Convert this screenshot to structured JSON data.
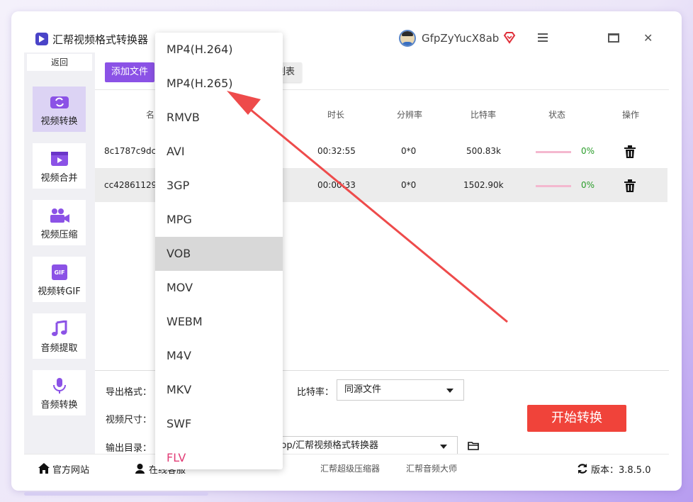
{
  "window": {
    "title": "汇帮视频格式转换器",
    "username": "GfpZyYucX8ab"
  },
  "sidebar": {
    "back_label": "返回",
    "items": [
      {
        "label": "视频转换",
        "icon": "video-convert-icon",
        "active": true
      },
      {
        "label": "视频合并",
        "icon": "video-merge-icon",
        "active": false
      },
      {
        "label": "视频压缩",
        "icon": "video-compress-icon",
        "active": false
      },
      {
        "label": "视频转GIF",
        "icon": "gif-icon",
        "active": false
      },
      {
        "label": "音频提取",
        "icon": "music-note-icon",
        "active": false
      },
      {
        "label": "音频转换",
        "icon": "microphone-icon",
        "active": false
      }
    ]
  },
  "toolbar": {
    "add_file_label": "添加文件",
    "list_partial_label": "列表"
  },
  "table": {
    "headers": {
      "name": "名",
      "duration": "时长",
      "resolution": "分辨率",
      "bitrate": "比特率",
      "status": "状态",
      "action": "操作"
    },
    "rows": [
      {
        "name": "8c1787c9dca",
        "duration": "00:32:55",
        "resolution": "0*0",
        "bitrate": "500.83k",
        "progress_pct": "0%",
        "progress": 0
      },
      {
        "name": "cc42861129",
        "duration": "00:00:33",
        "resolution": "0*0",
        "bitrate": "1502.90k",
        "progress_pct": "0%",
        "progress": 0
      }
    ]
  },
  "settings": {
    "output_format_label": "导出格式：",
    "video_size_label": "视频尺寸：",
    "output_dir_label": "输出目录：",
    "bitrate_label": "比特率：",
    "bitrate_value": "同源文件",
    "output_dir_value": "sktop/汇帮视频格式转换器",
    "start_button": "开始转换"
  },
  "statusbar": {
    "website": "官方网站",
    "support": "在线客服",
    "compressor": "汇帮超级压缩器",
    "audio_master": "汇帮音频大师",
    "version": "版本：3.8.5.0"
  },
  "dropdown": {
    "options": [
      "MP4(H.264)",
      "MP4(H.265)",
      "RMVB",
      "AVI",
      "3GP",
      "MPG",
      "VOB",
      "MOV",
      "WEBM",
      "M4V",
      "MKV",
      "SWF",
      "FLV"
    ],
    "selected_index": 6,
    "accent_index": 12
  },
  "colors": {
    "accent_purple": "#8b52e6",
    "start_red": "#f0433a",
    "arrow_red": "#ee4b4b",
    "success_green": "#2a9d2a"
  }
}
